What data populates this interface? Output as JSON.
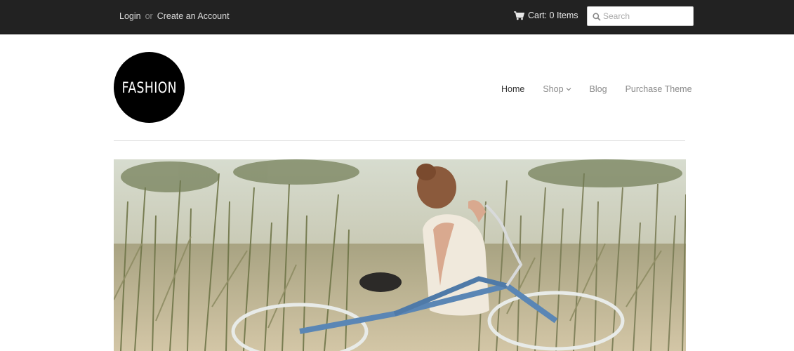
{
  "topbar": {
    "login": "Login",
    "or": "or",
    "create_account": "Create an Account",
    "cart": "Cart: 0 Items",
    "search_placeholder": "Search"
  },
  "logo": {
    "text": "FASHION"
  },
  "nav": {
    "items": [
      {
        "label": "Home"
      },
      {
        "label": "Shop"
      },
      {
        "label": "Blog"
      },
      {
        "label": "Purchase Theme"
      }
    ]
  },
  "icons": {
    "cart": "cart-icon",
    "search": "search-icon",
    "dropdown": "chevron-down-icon"
  },
  "colors": {
    "topbar_bg": "#222222",
    "logo_bg": "#000000",
    "nav_active": "#333333",
    "nav_inactive": "#8a8a8a"
  }
}
